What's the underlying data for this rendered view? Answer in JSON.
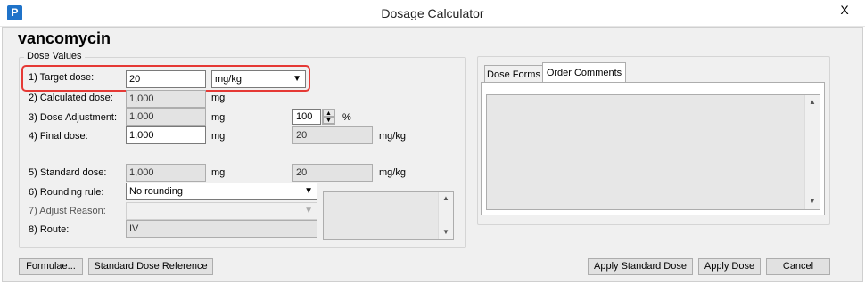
{
  "window": {
    "title": "Dosage Calculator",
    "app_icon": "P",
    "close_glyph": "X"
  },
  "drug_name": "vancomycin",
  "dose_values": {
    "legend": "Dose Values",
    "target_dose": {
      "label": "1) Target dose:",
      "value": "20",
      "unit_selected": "mg/kg"
    },
    "calculated_dose": {
      "label": "2) Calculated dose:",
      "value": "1,000",
      "unit": "mg"
    },
    "dose_adjustment": {
      "label": "3) Dose Adjustment:",
      "value": "1,000",
      "unit": "mg",
      "percent": "100",
      "percent_sign": "%"
    },
    "final_dose": {
      "label": "4) Final dose:",
      "value": "1,000",
      "unit": "mg",
      "per_kg_value": "20",
      "per_kg_unit": "mg/kg"
    },
    "standard_dose": {
      "label": "5) Standard dose:",
      "value": "1,000",
      "unit": "mg",
      "per_kg_value": "20",
      "per_kg_unit": "mg/kg"
    },
    "rounding_rule": {
      "label": "6) Rounding rule:",
      "selected": "No rounding"
    },
    "adjust_reason": {
      "label": "7) Adjust Reason:",
      "selected": ""
    },
    "route": {
      "label": "8) Route:",
      "value": "IV"
    }
  },
  "tabs": [
    {
      "label": "Dose Forms",
      "active": false
    },
    {
      "label": "Order Comments",
      "active": true
    }
  ],
  "buttons": {
    "formulae": "Formulae...",
    "standard_dose_reference": "Standard Dose Reference",
    "apply_standard_dose": "Apply Standard Dose",
    "apply_dose": "Apply Dose",
    "cancel": "Cancel"
  },
  "icons": {
    "dropdown": "chevron-down-icon",
    "spin_up": "spin-up-icon",
    "spin_down": "spin-down-icon",
    "scroll_up": "scroll-up-icon",
    "scroll_down": "scroll-down-icon"
  },
  "colors": {
    "highlight": "#e53935",
    "app_icon": "#1f73c9"
  }
}
